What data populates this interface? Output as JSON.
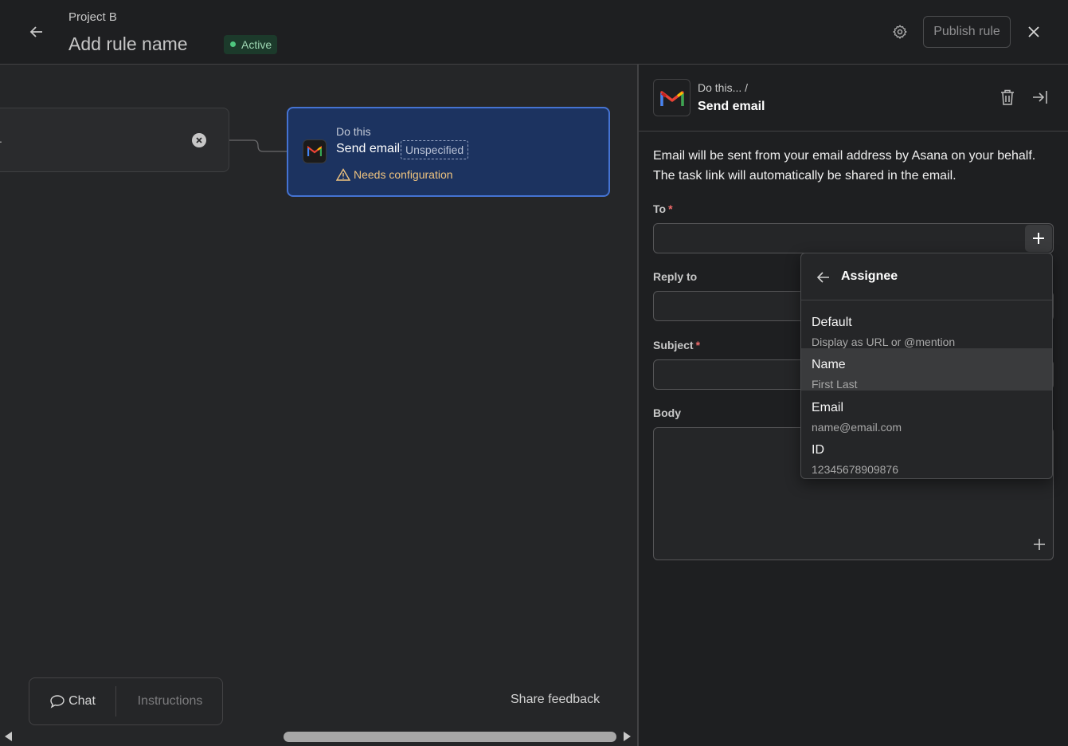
{
  "header": {
    "project": "Project B",
    "rule_name": "Add rule name",
    "status": "Active",
    "publish_label": "Publish rule"
  },
  "canvas": {
    "trigger_placeholder": ".",
    "action": {
      "kicker": "Do this",
      "title": "Send email",
      "tag": "Unspecified",
      "warning": "Needs configuration"
    },
    "bottom": {
      "chat_label": "Chat",
      "instructions_label": "Instructions",
      "share_feedback": "Share feedback"
    }
  },
  "panel": {
    "breadcrumb": "Do this...  /",
    "title": "Send email",
    "description": "Email will be sent from your email address by Asana on your behalf. The task link will automatically be shared in the email.",
    "fields": {
      "to": "To",
      "reply_to": "Reply to",
      "subject": "Subject",
      "body": "Body"
    }
  },
  "dropdown": {
    "title": "Assignee",
    "items": [
      {
        "label": "Default",
        "sub": "Display as URL or @mention"
      },
      {
        "label": "Name",
        "sub": "First Last"
      },
      {
        "label": "Email",
        "sub": "name@email.com"
      },
      {
        "label": "ID",
        "sub": "12345678909876"
      }
    ]
  },
  "colors": {
    "accent": "#4573d2",
    "action_card_bg": "#1c3360",
    "warning": "#f0c47f",
    "required": "#f06a6a",
    "active_dot": "#4ec77f"
  },
  "icons": [
    "back-arrow-icon",
    "gear-icon",
    "close-icon",
    "clear-circle-icon",
    "gmail-icon",
    "warning-triangle-icon",
    "chat-bubble-icon",
    "trash-icon",
    "collapse-panel-icon",
    "plus-icon",
    "scroll-left-icon",
    "scroll-right-icon"
  ]
}
